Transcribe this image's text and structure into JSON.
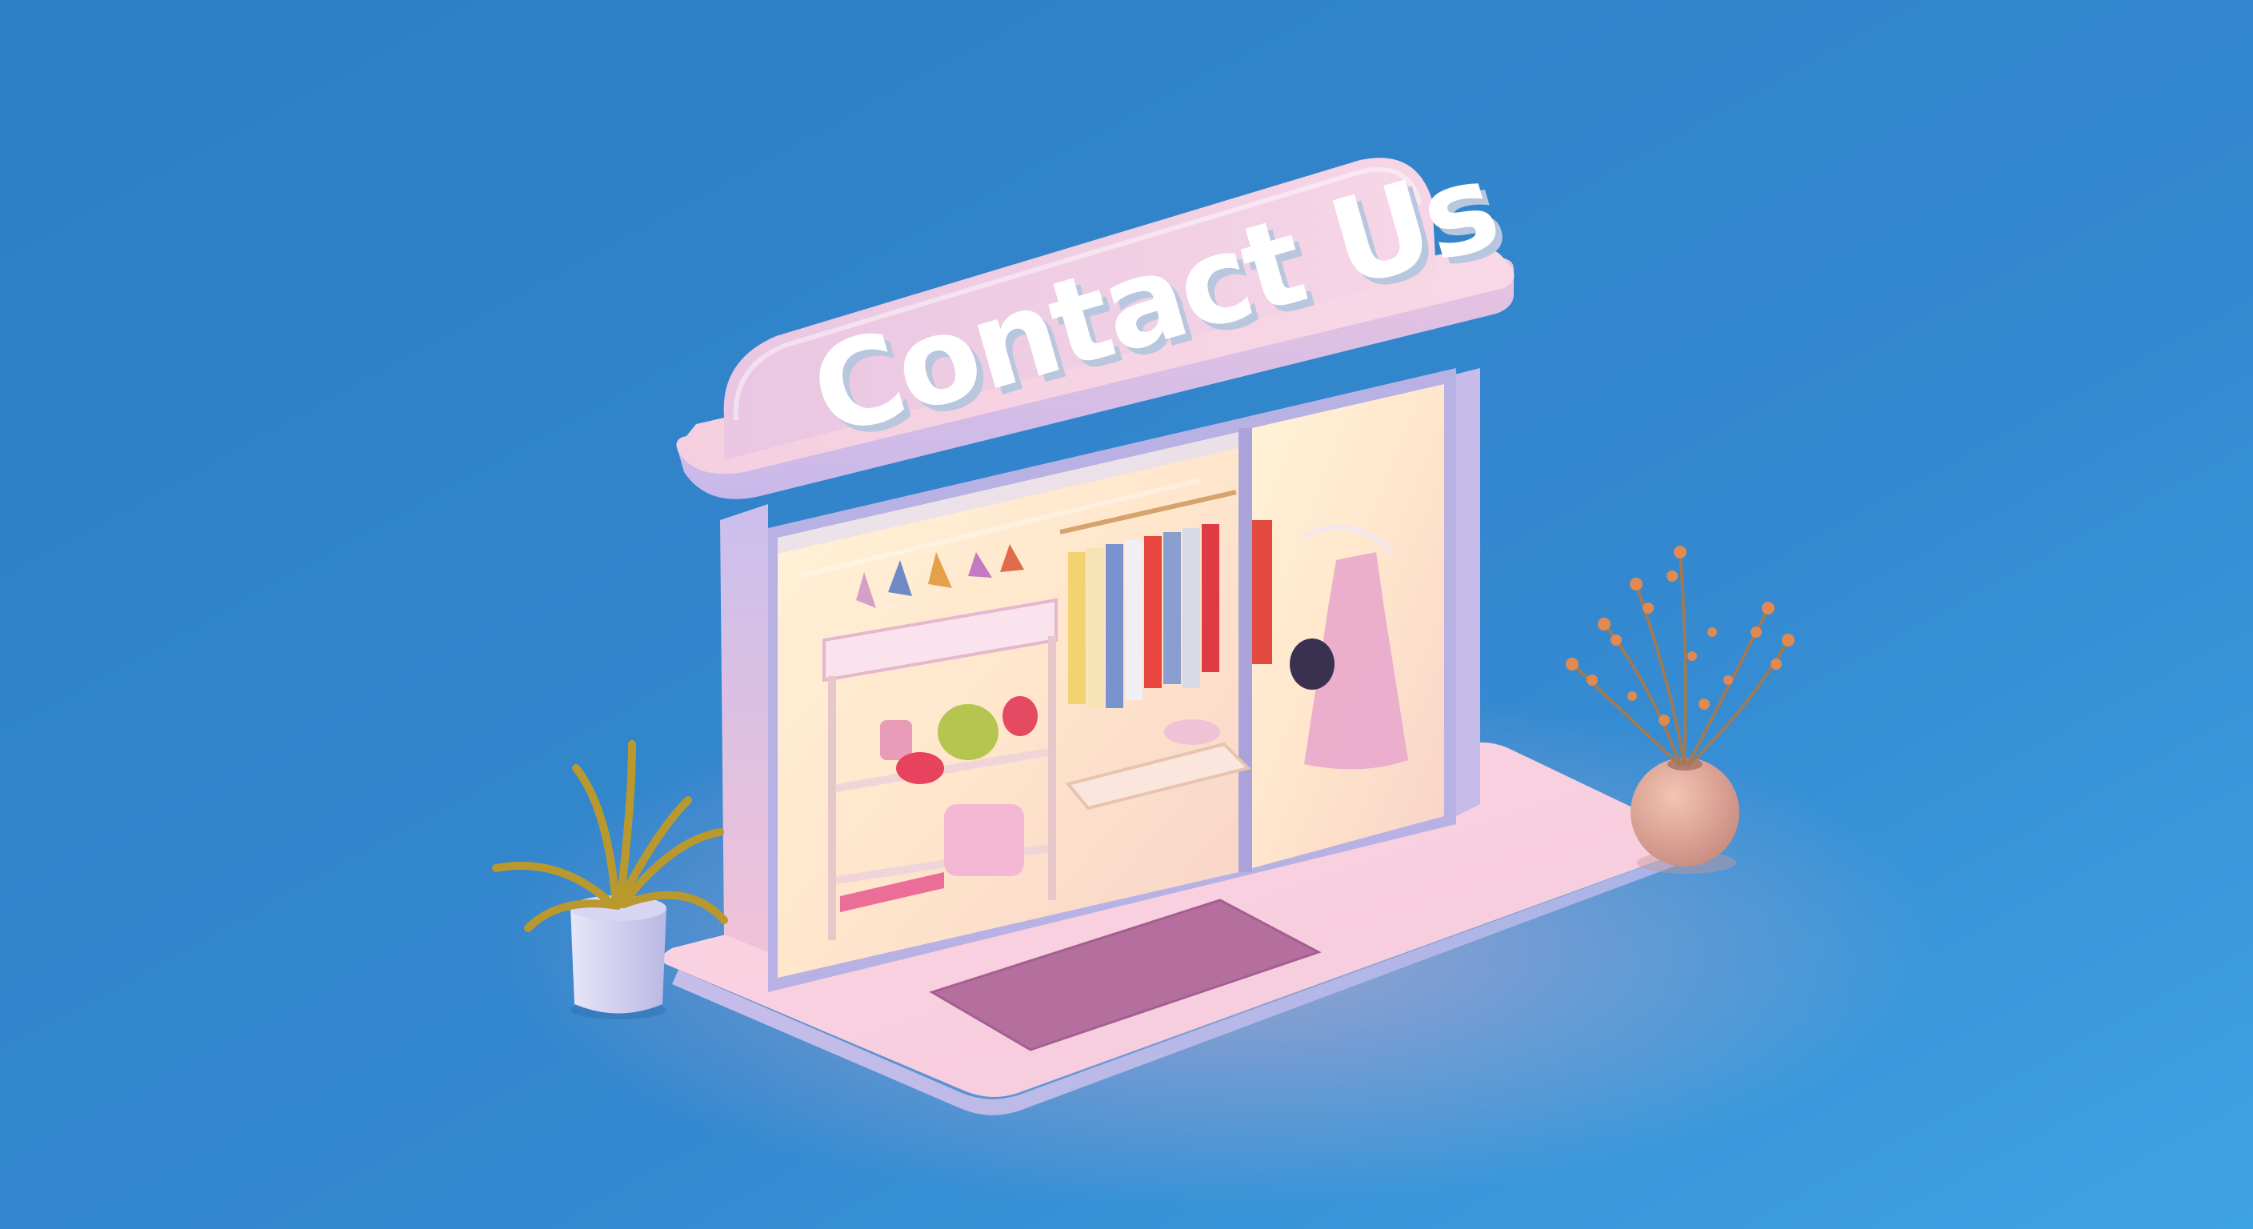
{
  "sign": {
    "text": "Contact Us"
  },
  "colors": {
    "background_top": "#2f82c6",
    "background_bottom": "#3a9ee0",
    "building_pink": "#f2c6dc",
    "building_lavender": "#bfb6e6",
    "interior_glow": "#ffe9cf",
    "doormat": "#b46f9e",
    "plant_leaf": "#b49a2e",
    "vase": "#e0a79a"
  },
  "icons": {
    "left_plant": "potted-plant-icon",
    "right_plant": "dried-flower-vase-icon"
  }
}
